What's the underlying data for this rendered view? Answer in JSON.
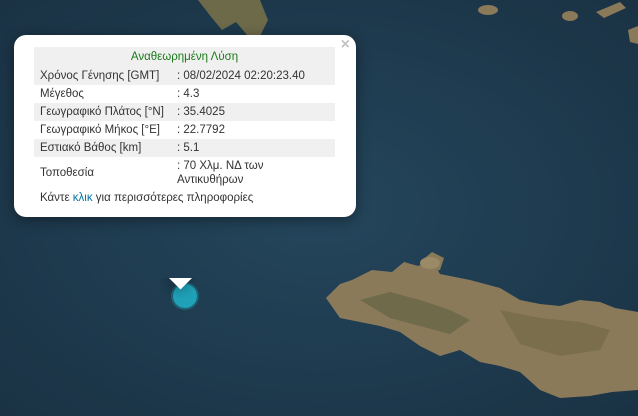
{
  "popup": {
    "title": "Αναθεωρημένη Λύση",
    "close_label": "×",
    "rows": [
      {
        "label": "Χρόνος Γένησης [GMT]",
        "value": ": 08/02/2024 02:20:23.40"
      },
      {
        "label": "Μέγεθος",
        "value": ": 4.3"
      },
      {
        "label": "Γεωγραφικό Πλάτος [°N]",
        "value": ": 35.4025"
      },
      {
        "label": "Γεωγραφικό Μήκος [°E]",
        "value": ": 22.7792"
      },
      {
        "label": "Εστιακό Βάθος [km]",
        "value": ": 5.1"
      },
      {
        "label": "Τοποθεσία",
        "value": ": 70 Χλμ. ΝΔ των Αντικυθήρων"
      }
    ],
    "more_prefix": "Κάντε ",
    "more_link": "κλικ",
    "more_suffix": " για περισσότερες πληροφορίες"
  },
  "colors": {
    "sea": "#1f3a4e",
    "marker": "#1fa2b8",
    "title": "#1a7a1a",
    "link": "#0078a8"
  }
}
